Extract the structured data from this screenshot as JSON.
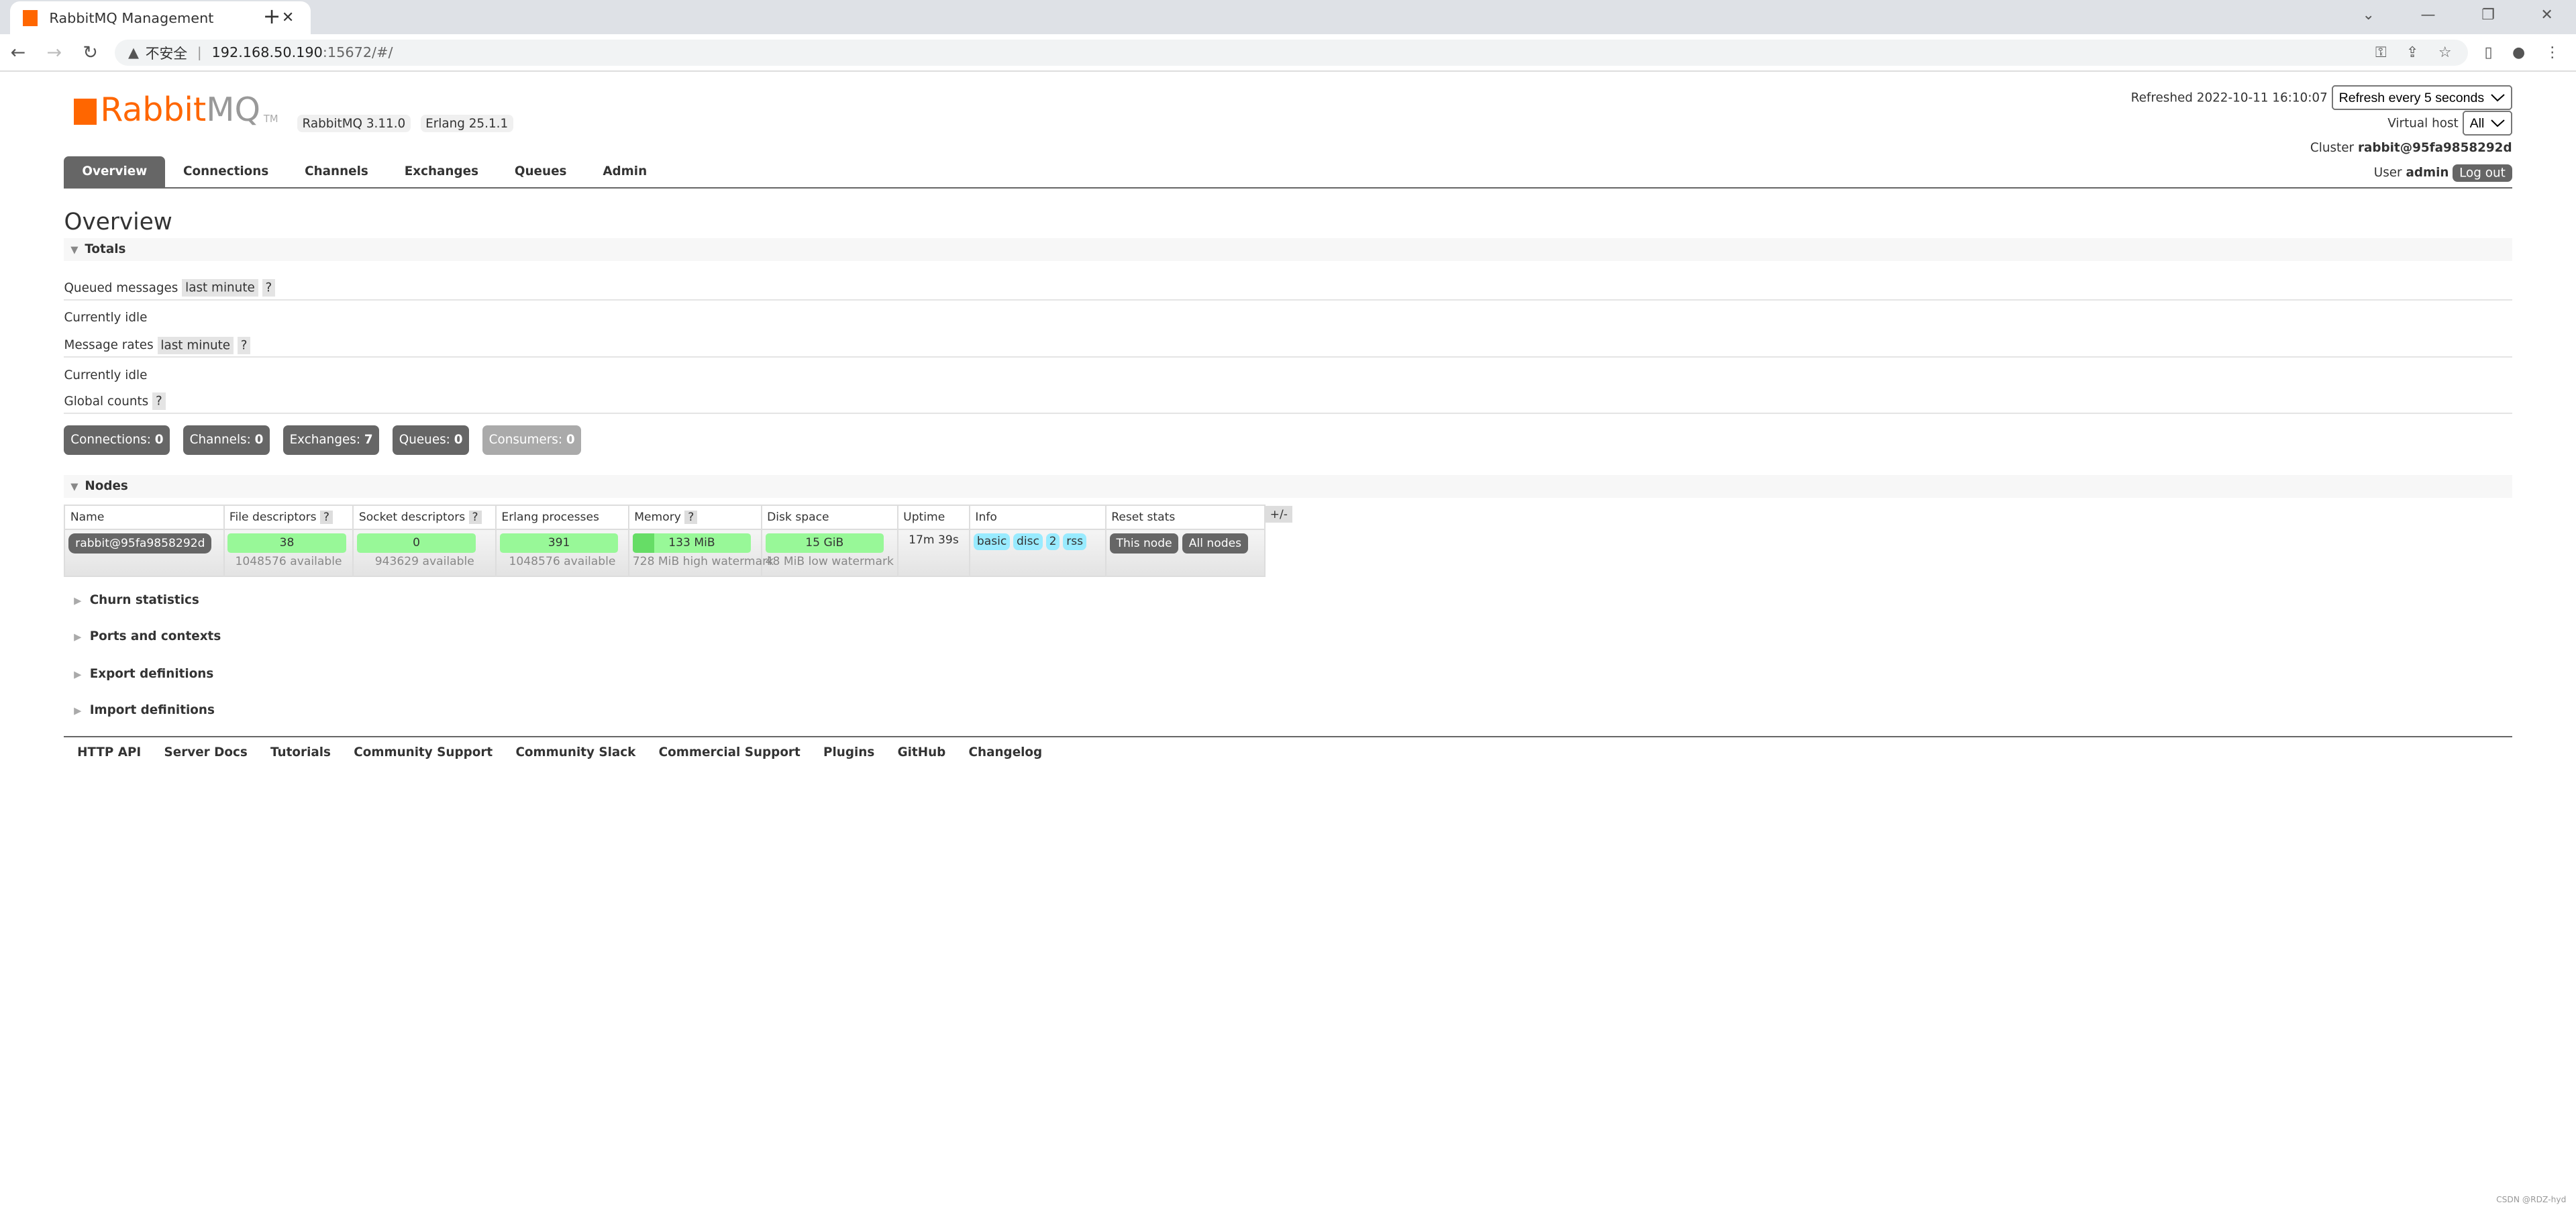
{
  "browser": {
    "tab_title": "RabbitMQ Management",
    "security_label": "不安全",
    "url_host": "192.168.50.190",
    "url_rest": ":15672/#/"
  },
  "header": {
    "logo_text_1": "Rabbit",
    "logo_text_2": "MQ",
    "logo_tm": "TM",
    "version": "RabbitMQ 3.11.0",
    "erlang": "Erlang 25.1.1",
    "refreshed": "Refreshed 2022-10-11 16:10:07",
    "refresh_option": "Refresh every 5 seconds",
    "vhost_label": "Virtual host",
    "vhost_value": "All",
    "cluster_label": "Cluster",
    "cluster_value": "rabbit@95fa9858292d",
    "user_label": "User",
    "user_value": "admin",
    "logout": "Log out"
  },
  "nav": [
    "Overview",
    "Connections",
    "Channels",
    "Exchanges",
    "Queues",
    "Admin"
  ],
  "title": "Overview",
  "totals": {
    "heading": "Totals",
    "queued_label": "Queued messages",
    "last_minute": "last minute",
    "help": "?",
    "idle": "Currently idle",
    "rates_label": "Message rates",
    "global_label": "Global counts",
    "counts": [
      {
        "label": "Connections:",
        "value": "0"
      },
      {
        "label": "Channels:",
        "value": "0"
      },
      {
        "label": "Exchanges:",
        "value": "7"
      },
      {
        "label": "Queues:",
        "value": "0"
      },
      {
        "label": "Consumers:",
        "value": "0"
      }
    ]
  },
  "nodes": {
    "heading": "Nodes",
    "columns": [
      "Name",
      "File descriptors",
      "Socket descriptors",
      "Erlang processes",
      "Memory",
      "Disk space",
      "Uptime",
      "Info",
      "Reset stats"
    ],
    "plus_minus": "+/-",
    "row": {
      "name": "rabbit@95fa9858292d",
      "fd": "38",
      "fd_avail": "1048576 available",
      "sd": "0",
      "sd_avail": "943629 available",
      "ep": "391",
      "ep_avail": "1048576 available",
      "mem": "133 MiB",
      "mem_fraction": 0.18,
      "mem_sub": "728 MiB high watermark",
      "disk": "15 GiB",
      "disk_sub": "48 MiB low watermark",
      "uptime": "17m 39s",
      "info": [
        "basic",
        "disc",
        "2",
        "rss"
      ],
      "this_node": "This node",
      "all_nodes": "All nodes"
    }
  },
  "collapsed": [
    "Churn statistics",
    "Ports and contexts",
    "Export definitions",
    "Import definitions"
  ],
  "footer": [
    "HTTP API",
    "Server Docs",
    "Tutorials",
    "Community Support",
    "Community Slack",
    "Commercial Support",
    "Plugins",
    "GitHub",
    "Changelog"
  ],
  "watermark": "CSDN @RDZ-hyd"
}
